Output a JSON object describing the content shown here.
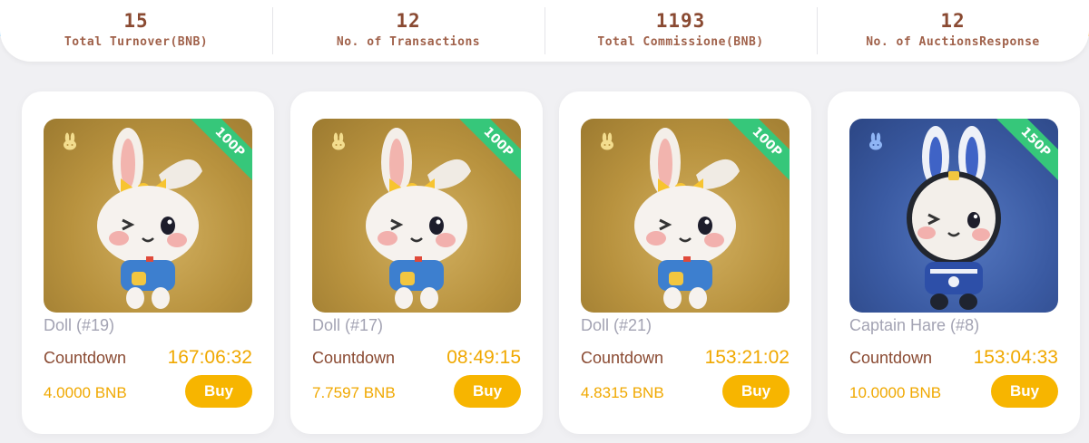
{
  "stats": [
    {
      "value": "15",
      "label": "Total Turnover(BNB)"
    },
    {
      "value": "12",
      "label": "No. of Transactions"
    },
    {
      "value": "1193",
      "label": "Total Commissione(BNB)"
    },
    {
      "value": "12",
      "label": "No. of AuctionsResponse"
    }
  ],
  "cards": [
    {
      "name": "Doll (#19)",
      "countdown_label": "Countdown",
      "countdown": "167:06:32",
      "price": "4.0000 BNB",
      "buy_label": "Buy",
      "ribbon": "100P",
      "theme": "gold",
      "ribbon_color": "#36c77a"
    },
    {
      "name": "Doll (#17)",
      "countdown_label": "Countdown",
      "countdown": "08:49:15",
      "price": "7.7597 BNB",
      "buy_label": "Buy",
      "ribbon": "100P",
      "theme": "gold",
      "ribbon_color": "#36c77a"
    },
    {
      "name": "Doll (#21)",
      "countdown_label": "Countdown",
      "countdown": "153:21:02",
      "price": "4.8315 BNB",
      "buy_label": "Buy",
      "ribbon": "100P",
      "theme": "gold",
      "ribbon_color": "#36c77a"
    },
    {
      "name": "Captain Hare (#8)",
      "countdown_label": "Countdown",
      "countdown": "153:04:33",
      "price": "10.0000 BNB",
      "buy_label": "Buy",
      "ribbon": "150P",
      "theme": "blue",
      "ribbon_color": "#36c77a"
    }
  ],
  "colors": {
    "accent": "#f7b500",
    "brown": "#8a4a32",
    "muted": "#a3a3b3"
  },
  "icons": {
    "badge": "bunny-badge-icon",
    "nft": "bunny-nft-image"
  }
}
